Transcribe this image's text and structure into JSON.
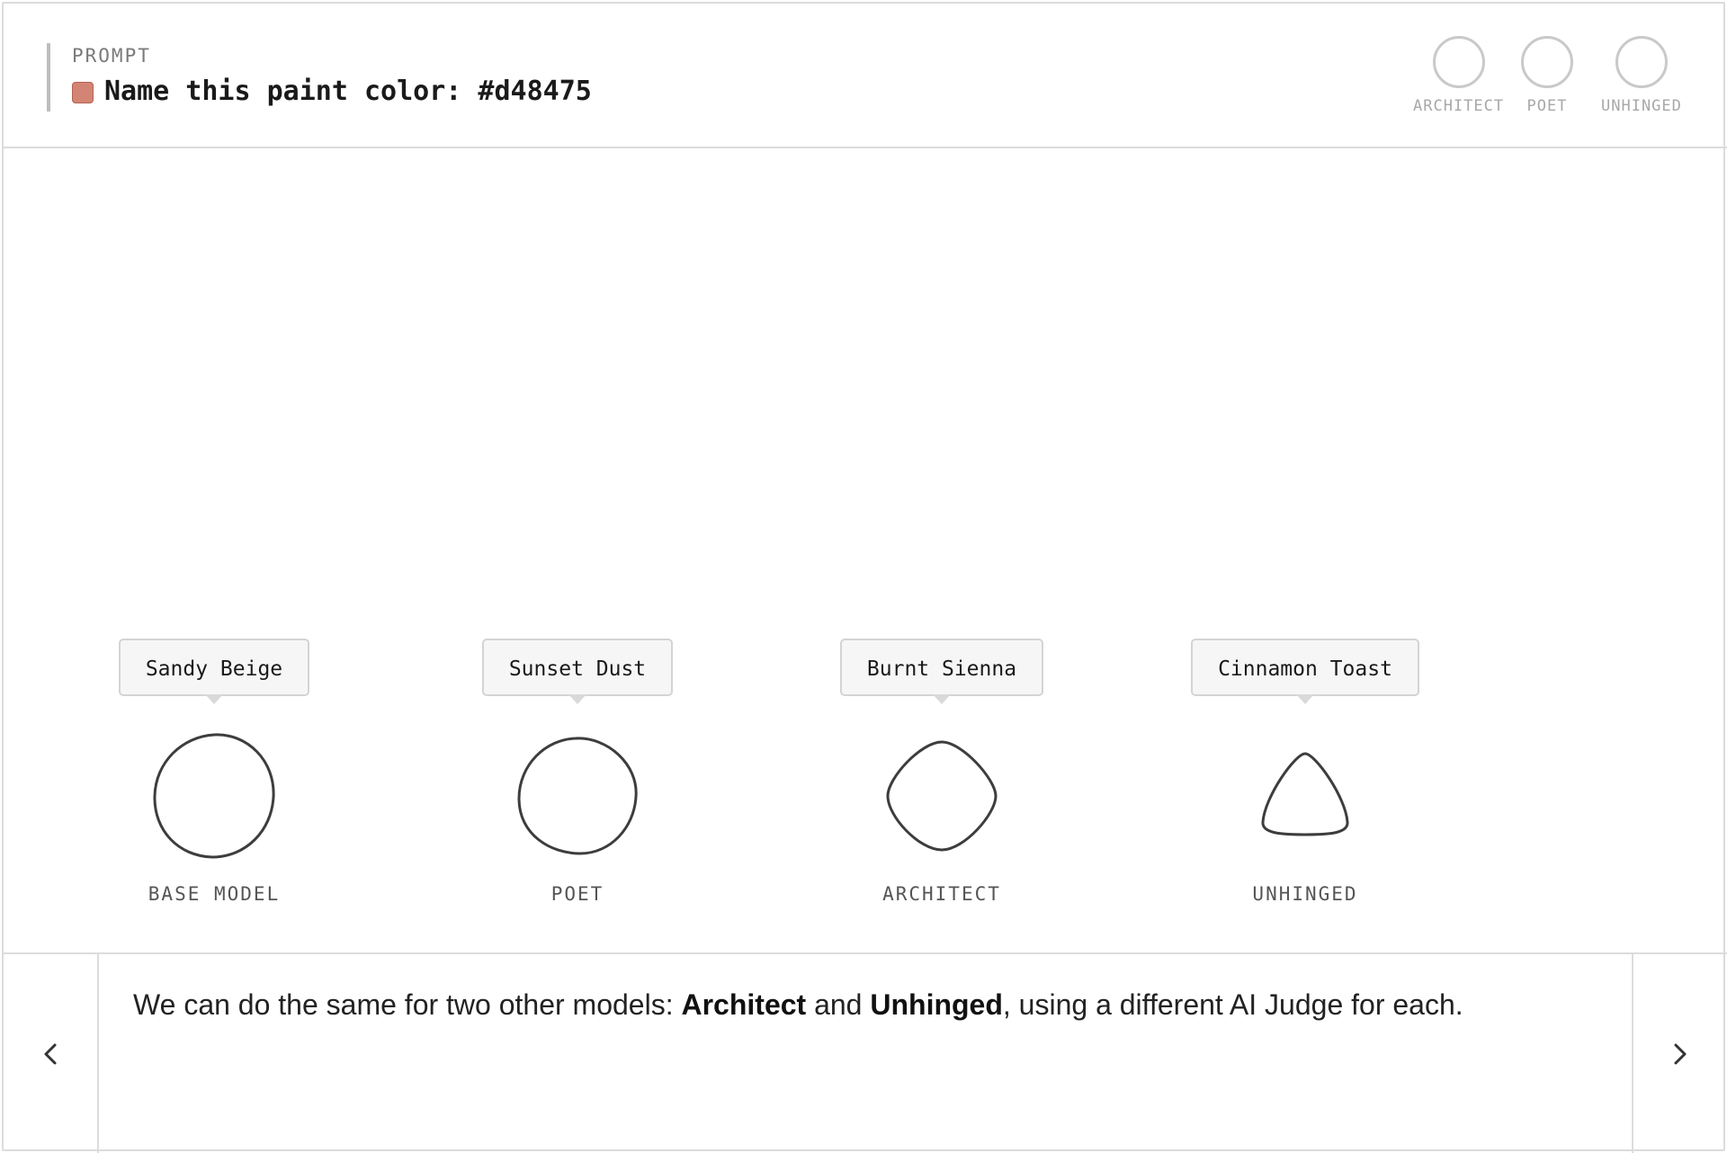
{
  "header": {
    "prompt_label": "PROMPT",
    "prompt_text": "Name this paint color: #d48475",
    "swatch_color": "#d48475",
    "legend": [
      {
        "label": "ARCHITECT"
      },
      {
        "label": "POET"
      },
      {
        "label": "UNHINGED"
      }
    ]
  },
  "models": [
    {
      "label": "BASE MODEL",
      "answer": "Sandy Beige"
    },
    {
      "label": "POET",
      "answer": "Sunset Dust"
    },
    {
      "label": "ARCHITECT",
      "answer": "Burnt Sienna"
    },
    {
      "label": "UNHINGED",
      "answer": "Cinnamon Toast"
    }
  ],
  "footer": {
    "caption_before": "We can do the same for two other models: ",
    "caption_bold_1": "Architect",
    "caption_middle": " and ",
    "caption_bold_2": "Unhinged",
    "caption_after": ", using a different AI Judge for each.",
    "prev_icon": "chevron-left-icon",
    "next_icon": "chevron-right-icon"
  }
}
